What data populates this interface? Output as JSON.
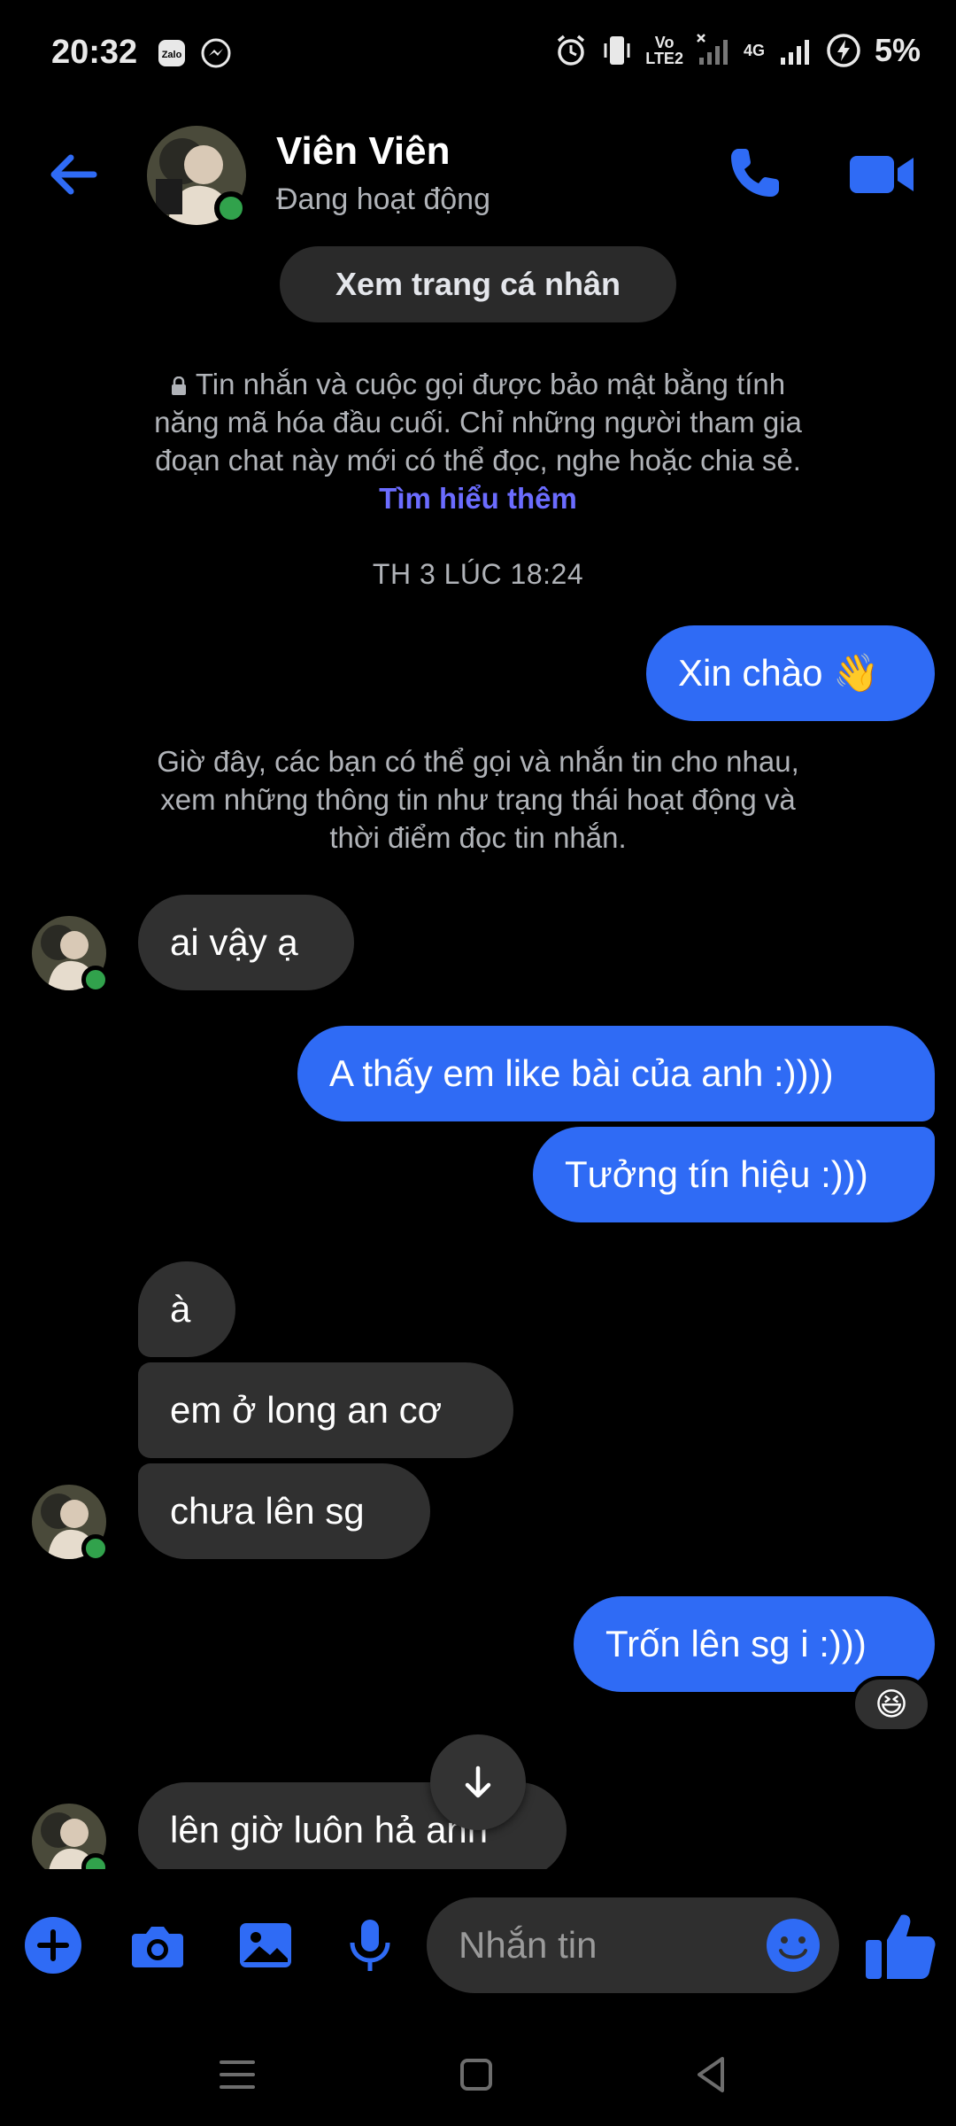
{
  "status_bar": {
    "time": "20:32",
    "battery": "5%",
    "network_volte": "Vo",
    "network_lte": "LTE2",
    "network_4g": "4G"
  },
  "header": {
    "name": "Viên Viên",
    "status": "Đang hoạt động",
    "accent": "#2f6bf5"
  },
  "profile_chip": "Xem trang cá nhân",
  "e2e": {
    "text": "Tin nhắn và cuộc gọi được bảo mật bằng tính năng mã hóa đầu cuối. Chỉ những người tham gia đoạn chat này mới có thể đọc, nghe hoặc chia sẻ.",
    "link": "Tìm hiểu thêm"
  },
  "timestamp": "TH 3 LÚC 18:24",
  "info_note": "Giờ đây, các bạn có thể gọi và nhắn tin cho nhau, xem những thông tin như trạng thái hoạt động và thời điểm đọc tin nhắn.",
  "messages": [
    {
      "from": "me",
      "text": "Xin chào 👋"
    },
    {
      "from": "them",
      "text": "ai vậy ạ"
    },
    {
      "from": "me",
      "text": "A thấy em like bài của anh :))))"
    },
    {
      "from": "me",
      "text": "Tưởng tín hiệu :)))"
    },
    {
      "from": "them",
      "text": "à"
    },
    {
      "from": "them",
      "text": "em ở long an cơ"
    },
    {
      "from": "them",
      "text": "chưa lên sg"
    },
    {
      "from": "me",
      "text": "Trốn lên sg i :)))"
    },
    {
      "from": "them",
      "text": "lên giờ luôn hả anh"
    }
  ],
  "reaction": "😆",
  "composer": {
    "placeholder": "Nhắn tin"
  }
}
